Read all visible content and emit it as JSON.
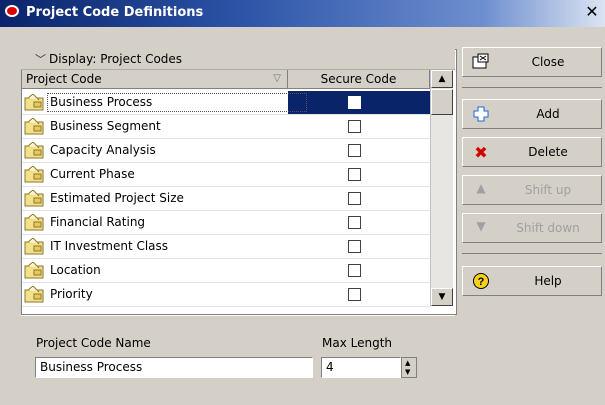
{
  "window": {
    "title": "Project Code Definitions",
    "close_glyph": "✕"
  },
  "display_bar": {
    "label": "Display: Project Codes"
  },
  "columns": {
    "code": "Project Code",
    "secure": "Secure Code"
  },
  "rows": [
    {
      "label": "Business Process",
      "secure": false,
      "selected": true
    },
    {
      "label": "Business Segment",
      "secure": false
    },
    {
      "label": "Capacity Analysis",
      "secure": false
    },
    {
      "label": "Current Phase",
      "secure": false
    },
    {
      "label": "Estimated Project Size",
      "secure": false
    },
    {
      "label": "Financial Rating",
      "secure": false
    },
    {
      "label": "IT Investment Class",
      "secure": false
    },
    {
      "label": "Location",
      "secure": false
    },
    {
      "label": "Priority",
      "secure": false
    }
  ],
  "details": {
    "name_label": "Project Code Name",
    "name_value": "Business Process",
    "max_length_label": "Max Length",
    "max_length_value": "4"
  },
  "buttons": {
    "close": "Close",
    "add": "Add",
    "delete": "Delete",
    "shift_up": "Shift up",
    "shift_down": "Shift down",
    "help": "Help"
  },
  "colors": {
    "selection": "#0a246a",
    "title_gradient_start": "#0a246a",
    "delete_icon": "#d00000"
  },
  "icons": {
    "code_row": "folder-tag-icon",
    "close": "window-close-icon",
    "add": "plus-icon",
    "delete": "x-icon",
    "shift_up": "triangle-up-icon",
    "shift_down": "triangle-down-icon",
    "help": "help-icon"
  }
}
